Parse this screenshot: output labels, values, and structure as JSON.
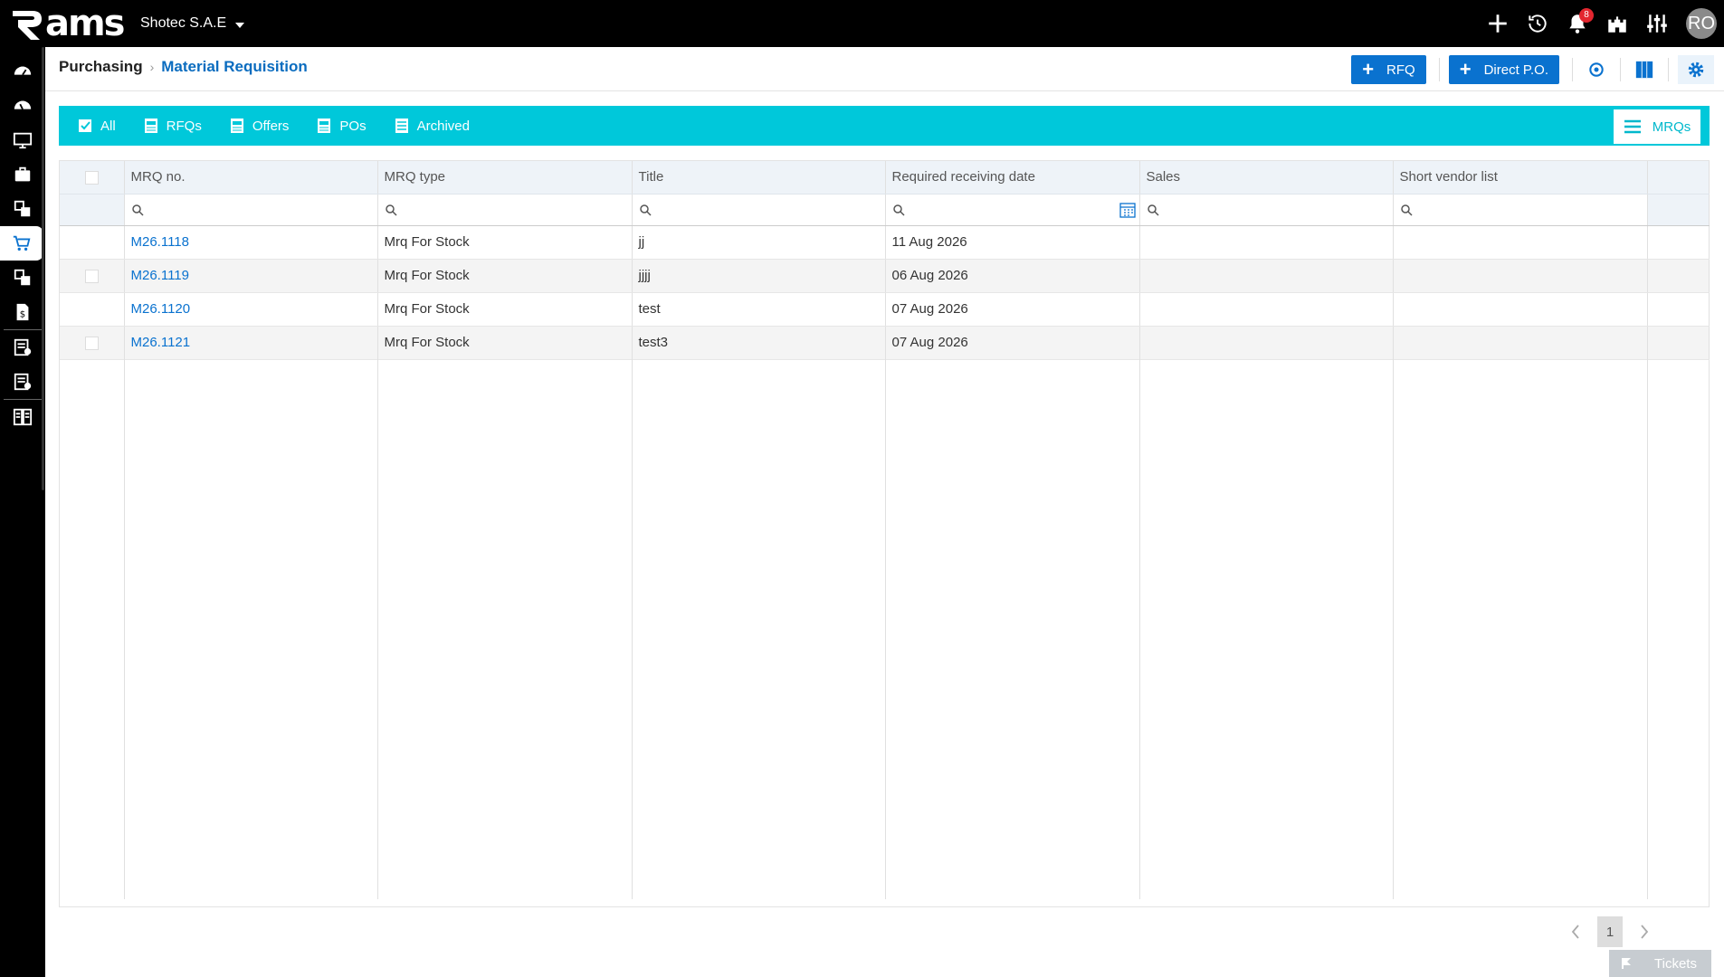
{
  "app": {
    "logo_text": "ams",
    "company": "Shotec S.A.E",
    "notifications_count": "8",
    "user_initials": "RO"
  },
  "breadcrumb": {
    "root": "Purchasing",
    "current": "Material Requisition"
  },
  "actions": {
    "rfq_label": "RFQ",
    "direct_po_label": "Direct P.O."
  },
  "tabs": [
    {
      "label": "All",
      "icon": "checkbox-icon"
    },
    {
      "label": "RFQs",
      "icon": "rfq-doc-icon"
    },
    {
      "label": "Offers",
      "icon": "offer-doc-icon"
    },
    {
      "label": "POs",
      "icon": "po-doc-icon"
    },
    {
      "label": "Archived",
      "icon": "archive-doc-icon"
    }
  ],
  "view_tab": {
    "label": "MRQs",
    "icon": "list-icon"
  },
  "table": {
    "columns": [
      "MRQ no.",
      "MRQ type",
      "Title",
      "Required receiving date",
      "Sales",
      "Short vendor list"
    ],
    "rows": [
      {
        "mrq_no": "M26.1118",
        "type": "Mrq For Stock",
        "title": "jj",
        "date": "11 Aug 2026",
        "sales": "",
        "vendors": ""
      },
      {
        "mrq_no": "M26.1119",
        "type": "Mrq For Stock",
        "title": "jjjj",
        "date": "06 Aug 2026",
        "sales": "",
        "vendors": ""
      },
      {
        "mrq_no": "M26.1120",
        "type": "Mrq For Stock",
        "title": "test",
        "date": "07 Aug 2026",
        "sales": "",
        "vendors": ""
      },
      {
        "mrq_no": "M26.1121",
        "type": "Mrq For Stock",
        "title": "test3",
        "date": "07 Aug 2026",
        "sales": "",
        "vendors": ""
      }
    ]
  },
  "pager": {
    "current_page": "1"
  },
  "tickets_label": "Tickets",
  "colors": {
    "accent": "#0a72cf",
    "tabstrip": "#00c8da",
    "topbar": "#000000",
    "badge": "#e3262f"
  }
}
